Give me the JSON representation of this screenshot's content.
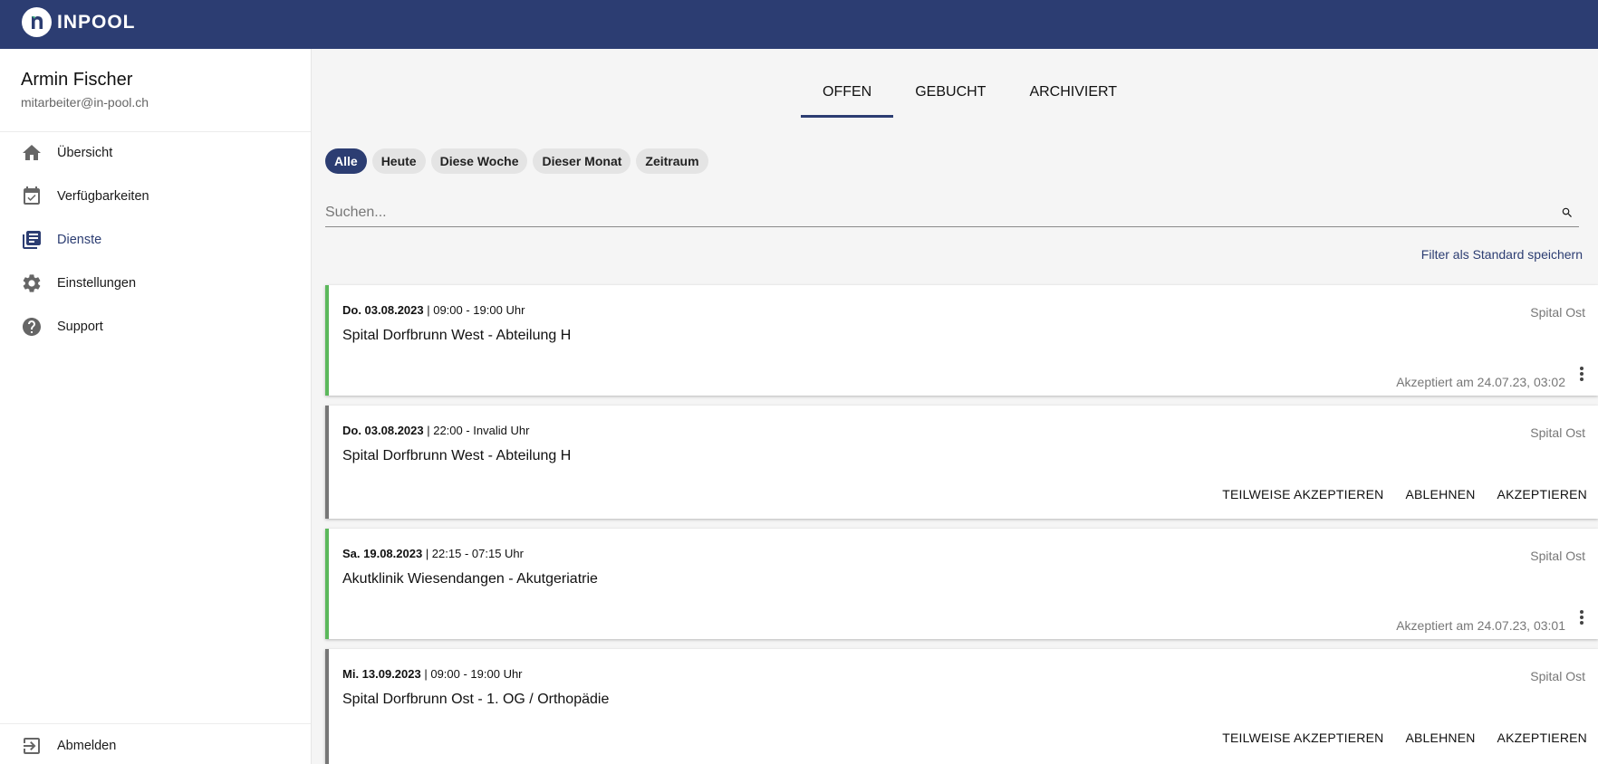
{
  "app": {
    "brand": "INPOOL"
  },
  "user": {
    "name": "Armin Fischer",
    "email": "mitarbeiter@in-pool.ch"
  },
  "nav": {
    "items": [
      {
        "label": "Übersicht",
        "icon": "home-icon"
      },
      {
        "label": "Verfügbarkeiten",
        "icon": "calendar-check-icon"
      },
      {
        "label": "Dienste",
        "icon": "list-icon",
        "active": true
      },
      {
        "label": "Einstellungen",
        "icon": "gear-icon"
      },
      {
        "label": "Support",
        "icon": "help-icon"
      }
    ],
    "logout": "Abmelden"
  },
  "tabs": [
    "OFFEN",
    "GEBUCHT",
    "ARCHIVIERT"
  ],
  "active_tab": "OFFEN",
  "filters": [
    "Alle",
    "Heute",
    "Diese Woche",
    "Dieser Monat",
    "Zeitraum"
  ],
  "active_filter": "Alle",
  "search": {
    "placeholder": "Suchen..."
  },
  "save_filter_label": "Filter als Standard speichern",
  "cards": [
    {
      "day": "Do. 03.08.2023",
      "time": " | 09:00 - 19:00 Uhr",
      "title": "Spital Dorfbrunn West - Abteilung H",
      "location": "Spital Ost",
      "status": "accepted",
      "accepted_text": "Akzeptiert am 24.07.23, 03:02"
    },
    {
      "day": "Do. 03.08.2023",
      "time": " | 22:00 - Invalid Uhr",
      "title": "Spital Dorfbrunn West - Abteilung H",
      "location": "Spital Ost",
      "status": "pending",
      "actions": [
        "TEILWEISE AKZEPTIEREN",
        "ABLEHNEN",
        "AKZEPTIEREN"
      ]
    },
    {
      "day": "Sa. 19.08.2023",
      "time": " | 22:15 - 07:15 Uhr",
      "title": "Akutklinik Wiesendangen - Akutgeriatrie",
      "location": "Spital Ost",
      "status": "accepted",
      "accepted_text": "Akzeptiert am 24.07.23, 03:01"
    },
    {
      "day": "Mi. 13.09.2023",
      "time": " | 09:00 - 19:00 Uhr",
      "title": "Spital Dorfbrunn Ost - 1. OG / Orthopädie",
      "location": "Spital Ost",
      "status": "pending",
      "actions": [
        "TEILWEISE AKZEPTIEREN",
        "ABLEHNEN",
        "AKZEPTIEREN"
      ]
    }
  ],
  "colors": {
    "brand": "#2c3d72",
    "accepted": "#5cb85c",
    "pending": "#777777"
  }
}
